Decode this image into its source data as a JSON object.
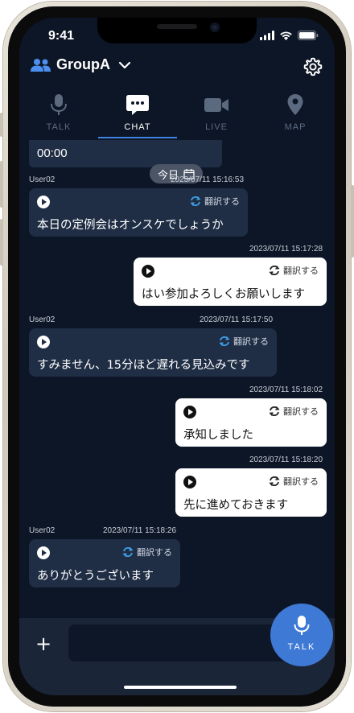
{
  "status_bar": {
    "time": "9:41"
  },
  "header": {
    "group_name": "GroupA"
  },
  "tabs": [
    {
      "label": "TALK",
      "icon": "microphone-icon",
      "active": false
    },
    {
      "label": "CHAT",
      "icon": "chat-bubble-icon",
      "active": true
    },
    {
      "label": "LIVE",
      "icon": "video-camera-icon",
      "active": false
    },
    {
      "label": "MAP",
      "icon": "map-pin-icon",
      "active": false
    }
  ],
  "chat": {
    "timer": "00:00",
    "date_chip": "今日",
    "translate_label": "翻訳する",
    "messages": [
      {
        "direction": "in",
        "sender": "User02",
        "timestamp": "2023/07/11 15:16:53",
        "text": "本日の定例会はオンスケでしょうか"
      },
      {
        "direction": "out",
        "sender": "",
        "timestamp": "2023/07/11 15:17:28",
        "text": "はい参加よろしくお願いします"
      },
      {
        "direction": "in",
        "sender": "User02",
        "timestamp": "2023/07/11 15:17:50",
        "text": "すみません、15分ほど遅れる見込みです"
      },
      {
        "direction": "out",
        "sender": "",
        "timestamp": "2023/07/11 15:18:02",
        "text": "承知しました"
      },
      {
        "direction": "out",
        "sender": "",
        "timestamp": "2023/07/11 15:18:20",
        "text": "先に進めておきます"
      },
      {
        "direction": "in",
        "sender": "User02",
        "timestamp": "2023/07/11 15:18:26",
        "text": "ありがとうございます"
      }
    ]
  },
  "input_bar": {
    "plus": "+",
    "placeholder": "",
    "talk_label": "TALK"
  },
  "colors": {
    "background": "#0d1626",
    "bubble_in": "#1f2d45",
    "bubble_out": "#ffffff",
    "accent": "#3f82e0",
    "translate_icon": "#3f9fe8"
  }
}
